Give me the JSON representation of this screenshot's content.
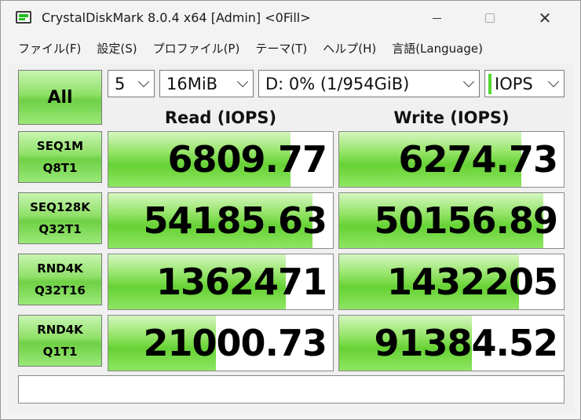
{
  "window": {
    "title": "CrystalDiskMark 8.0.4 x64 [Admin] <0Fill>"
  },
  "menu": {
    "items": [
      {
        "label": "ファイル(F)"
      },
      {
        "label": "設定(S)"
      },
      {
        "label": "プロファイル(P)"
      },
      {
        "label": "テーマ(T)"
      },
      {
        "label": "ヘルプ(H)"
      },
      {
        "label": "言語(Language)"
      }
    ]
  },
  "controls": {
    "all_label": "All",
    "count": "5",
    "size": "16MiB",
    "drive": "D: 0% (1/954GiB)",
    "unit": "IOPS"
  },
  "headers": {
    "read": "Read (IOPS)",
    "write": "Write (IOPS)"
  },
  "tests": [
    {
      "line1": "SEQ1M",
      "line2": "Q8T1",
      "read": "6809.77",
      "write": "6274.73",
      "read_fill": 0.81,
      "write_fill": 0.81
    },
    {
      "line1": "SEQ128K",
      "line2": "Q32T1",
      "read": "54185.63",
      "write": "50156.89",
      "read_fill": 0.91,
      "write_fill": 0.91
    },
    {
      "line1": "RND4K",
      "line2": "Q32T16",
      "read": "1362471",
      "write": "1432205",
      "read_fill": 0.79,
      "write_fill": 0.8
    },
    {
      "line1": "RND4K",
      "line2": "Q1T1",
      "read": "21000.73",
      "write": "91384.52",
      "read_fill": 0.48,
      "write_fill": 0.59
    }
  ],
  "comment": "",
  "colors": {
    "accent_green": "#66d234",
    "window_bg": "#f3f3f3"
  }
}
